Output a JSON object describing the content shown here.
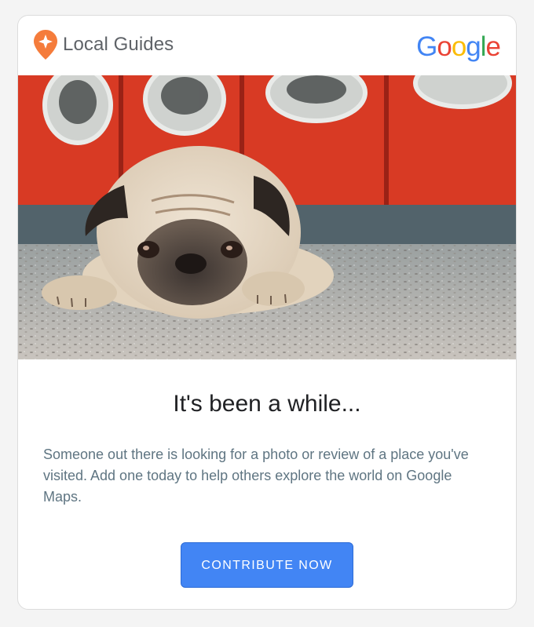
{
  "header": {
    "brand_name": "Local Guides",
    "brand_icon": "local-guides-pin-icon",
    "logo": [
      {
        "char": "G",
        "color": "#4285F4"
      },
      {
        "char": "o",
        "color": "#EA4335"
      },
      {
        "char": "o",
        "color": "#FBBC05"
      },
      {
        "char": "g",
        "color": "#4285F4"
      },
      {
        "char": "l",
        "color": "#34A853"
      },
      {
        "char": "e",
        "color": "#EA4335"
      }
    ]
  },
  "hero": {
    "subject": "pug lying on floor in front of red washing machines"
  },
  "main": {
    "headline": "It's been a while...",
    "body": "Someone out there is looking for a photo or review of a place you've visited. Add one today to help others explore the world on Google Maps.",
    "cta_label": "CONTRIBUTE NOW"
  },
  "colors": {
    "accent": "#4285F4",
    "pin": "#F57C3B",
    "text_muted": "#5F7582",
    "headline": "#202124"
  }
}
